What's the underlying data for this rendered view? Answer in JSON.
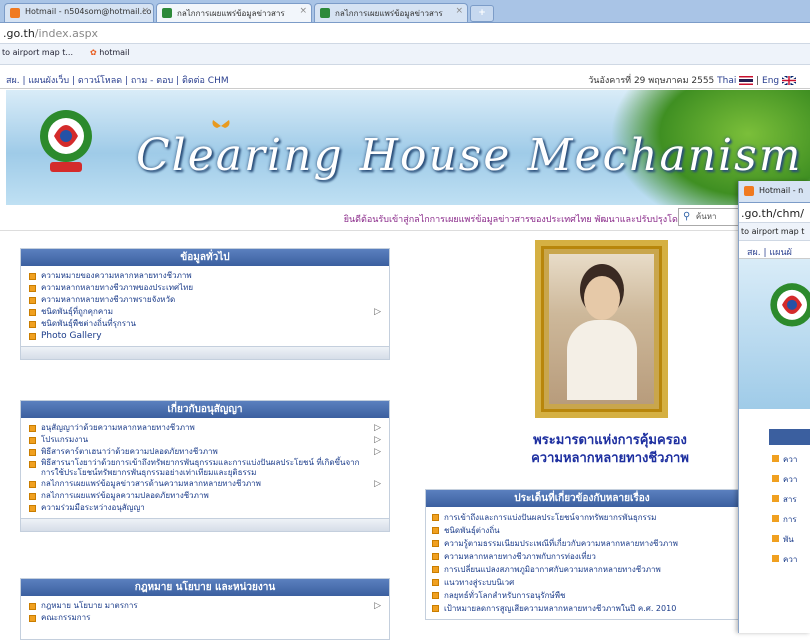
{
  "browser": {
    "tabs": [
      {
        "label": "Hotmail - n504som@hotmail.co",
        "active": false
      },
      {
        "label": "กลไกการเผยแพร่ข้อมูลข่าวสาร",
        "active": true
      },
      {
        "label": "กลไกการเผยแพร่ข้อมูลข่าวสาร",
        "active": false
      }
    ],
    "new_tab": "+",
    "url_host": ".go.th",
    "url_path": "/index.aspx",
    "favorites": [
      "to airport map t...",
      "hotmail"
    ]
  },
  "topnav": {
    "links": "สผ. | แผนผังเว็บ | ดาวน์โหลด | ถาม - ตอบ | ติดต่อ CHM",
    "date": "วันอังคารที่ 29 พฤษภาคม 2555",
    "lang_thai": "Thai",
    "lang_eng": "Eng"
  },
  "banner": {
    "title": "Clearing House Mechanism"
  },
  "welcome": {
    "text": "ยินดีต้อนรับเข้าสู่กลไกการเผยแพร่ข้อมูลข่าวสารของประเทศไทย พัฒนาและปรับปรุงโดย ::",
    "search_placeholder": "ค้นหา"
  },
  "box_general": {
    "title": "ข้อมูลทั่วไป",
    "items": [
      {
        "label": "ความหมายของความหลากหลายทางชีวภาพ",
        "arrow": false
      },
      {
        "label": "ความหลากหลายทางชีวภาพของประเทศไทย",
        "arrow": false
      },
      {
        "label": "ความหลากหลายทางชีวภาพรายจังหวัด",
        "arrow": false
      },
      {
        "label": "ชนิดพันธุ์ที่ถูกคุกคาม",
        "arrow": true
      },
      {
        "label": "ชนิดพันธุ์พืชต่างถิ่นที่รุกราน",
        "arrow": false
      },
      {
        "label": "Photo Gallery",
        "arrow": false
      }
    ]
  },
  "box_convention": {
    "title": "เกี่ยวกับอนุสัญญา",
    "items": [
      {
        "label": "อนุสัญญาว่าด้วยความหลากหลายทางชีวภาพ",
        "arrow": true
      },
      {
        "label": "โปรแกรมงาน",
        "arrow": true
      },
      {
        "label": "พิธีสารคาร์ตาเฮนาว่าด้วยความปลอดภัยทางชีวภาพ",
        "arrow": true
      },
      {
        "label": "พิธีสารนาโงยาว่าด้วยการเข้าถึงทรัพยากรพันธุกรรมและการแบ่งปันผลประโยชน์ ที่เกิดขึ้นจากการใช้ประโยชน์ทรัพยากรพันธุกรรมอย่างเท่าเทียมและยุติธรรม",
        "arrow": false
      },
      {
        "label": "กลไกการเผยแพร่ข้อมูลข่าวสารด้านความหลากหลายทางชีวภาพ",
        "arrow": true
      },
      {
        "label": "กลไกการเผยแพร่ข้อมูลความปลอดภัยทางชีวภาพ",
        "arrow": false
      },
      {
        "label": "ความร่วมมือระหว่างอนุสัญญา",
        "arrow": false
      }
    ]
  },
  "box_law": {
    "title": "กฎหมาย นโยบาย และหน่วยงาน",
    "items": [
      {
        "label": "กฎหมาย นโยบาย มาตรการ",
        "arrow": true
      },
      {
        "label": "คณะกรรมการ",
        "arrow": false
      }
    ]
  },
  "portrait": {
    "caption_line1": "พระมารดาแห่งการคุ้มครอง",
    "caption_line2": "ความหลากหลายทางชีวภาพ"
  },
  "box_issues": {
    "title": "ประเด็นที่เกี่ยวข้องกับหลายเรื่อง",
    "items": [
      "การเข้าถึงและการแบ่งปันผลประโยชน์จากทรัพยากรพันธุกรรม",
      "ชนิดพันธุ์ต่างถิ่น",
      "ความรู้ตามธรรมเนียมประเพณีที่เกี่ยวกับความหลากหลายทางชีวภาพ",
      "ความหลากหลายทางชีวภาพกับการท่องเที่ยว",
      "การเปลี่ยนแปลงสภาพภูมิอากาศกับความหลากหลายทางชีวภาพ",
      "แนวทางสู่ระบบนิเวศ",
      "กลยุทธ์ทั่วโลกสำหรับการอนุรักษ์พืช",
      "เป้าหมายลดการสูญเสียความหลากหลายทางชีวภาพในปี ค.ศ. 2010"
    ]
  },
  "second_window": {
    "tab": "Hotmail - n",
    "url": ".go.th/chm/",
    "fav": "to airport map t",
    "nav": "สผ. | แผนผั",
    "items": [
      "ควา",
      "ควา",
      "สาร",
      "การ",
      "พัน",
      "ควา"
    ]
  },
  "colors": {
    "header_blue": "#3b5f9f",
    "bullet_orange": "#f0a020",
    "link_blue": "#1b3c8a",
    "caption_blue": "#1d2fa0",
    "frame_gold": "#d5b042"
  }
}
